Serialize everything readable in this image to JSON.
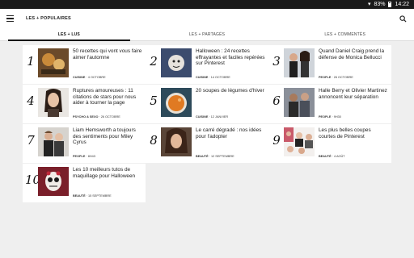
{
  "statusbar": {
    "battery": "83%",
    "time": "14:22"
  },
  "appbar": {
    "title": "LES + POPULAIRES"
  },
  "tabs": [
    {
      "label": "LES + LUS"
    },
    {
      "label": "LES + PARTAGÉS"
    },
    {
      "label": "LES + COMMENTÉS"
    }
  ],
  "articles": [
    {
      "rank": "1",
      "headline": "50 recettes qui vont vous faire aimer l'automne",
      "category": "CUISINE",
      "date": "4 OCTOBRE"
    },
    {
      "rank": "2",
      "headline": "Halloween : 24 recettes effrayantes et faciles repérées sur Pinterest",
      "category": "CUISINE",
      "date": "14 OCTOBRE"
    },
    {
      "rank": "3",
      "headline": "Quand Daniel Craig prend la défense de Monica Bellucci",
      "category": "PEOPLE",
      "date": "26 OCTOBRE"
    },
    {
      "rank": "4",
      "headline": "Ruptures amoureuses : 11 citations de stars pour nous aider à tourner la page",
      "category": "PSYCHO & SEXO",
      "date": "26 OCTOBRE"
    },
    {
      "rank": "5",
      "headline": "20 soupes de légumes d'hiver",
      "category": "CUISINE",
      "date": "12 JANVIER"
    },
    {
      "rank": "6",
      "headline": "Halle Berry et Olivier Martinez annoncent leur séparation",
      "category": "PEOPLE",
      "date": "9H30"
    },
    {
      "rank": "7",
      "headline": "Liam Hemsworth a toujours des sentiments pour Miley Cyrus",
      "category": "PEOPLE",
      "date": "8H43"
    },
    {
      "rank": "8",
      "headline": "Le carré dégradé : nos idées pour l'adopter",
      "category": "BEAUTÉ",
      "date": "12 SEPTEMBRE"
    },
    {
      "rank": "9",
      "headline": "Les plus belles coupes courtes de Pinterest",
      "category": "BEAUTÉ",
      "date": "4 AOÛT"
    },
    {
      "rank": "10",
      "headline": "Les 10 meilleurs tutos de maquillage pour Halloween",
      "category": "BEAUTÉ",
      "date": "15 SEPTEMBRE"
    }
  ]
}
